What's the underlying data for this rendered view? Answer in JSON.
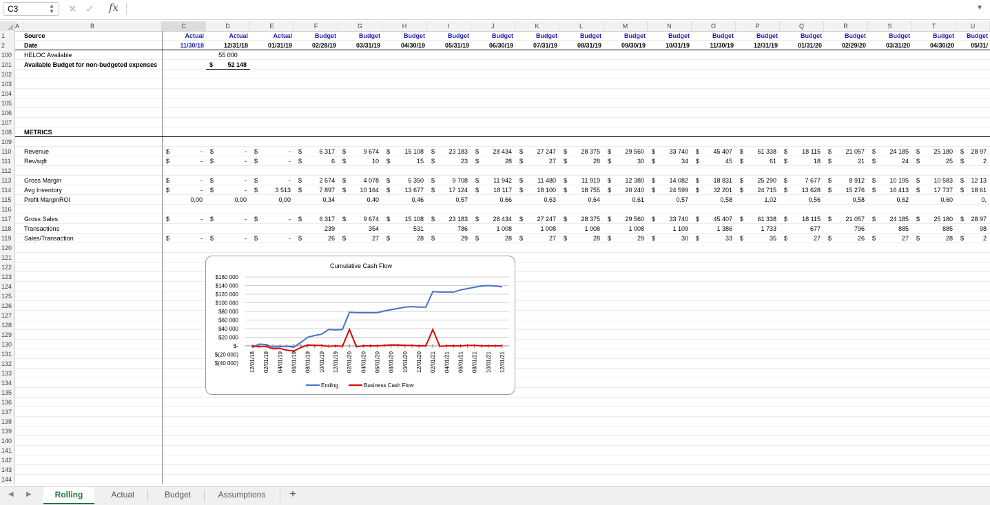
{
  "formula_bar": {
    "name_box": "C3",
    "cancel_icon": "✕",
    "enter_icon": "✓",
    "fx_label": "fx",
    "formula": ""
  },
  "columns": [
    {
      "letter": "A"
    },
    {
      "letter": "B"
    },
    {
      "letter": "C"
    },
    {
      "letter": "D"
    },
    {
      "letter": "E"
    },
    {
      "letter": "F"
    },
    {
      "letter": "G"
    },
    {
      "letter": "H"
    },
    {
      "letter": "I"
    },
    {
      "letter": "J"
    },
    {
      "letter": "K"
    },
    {
      "letter": "L"
    },
    {
      "letter": "M"
    },
    {
      "letter": "N"
    },
    {
      "letter": "O"
    },
    {
      "letter": "P"
    },
    {
      "letter": "Q"
    },
    {
      "letter": "R"
    },
    {
      "letter": "S"
    },
    {
      "letter": "T"
    },
    {
      "letter": "U"
    }
  ],
  "row_numbers": [
    "1",
    "2",
    "100",
    "101",
    "102",
    "103",
    "104",
    "105",
    "106",
    "107",
    "108",
    "109",
    "110",
    "111",
    "112",
    "113",
    "114",
    "115",
    "116",
    "117",
    "118",
    "119",
    "120",
    "121",
    "122",
    "123",
    "124",
    "125",
    "126",
    "127",
    "128",
    "129",
    "130",
    "131",
    "132",
    "133",
    "134",
    "135",
    "136",
    "137",
    "138",
    "139",
    "140",
    "141",
    "142",
    "143",
    "144"
  ],
  "labels": {
    "source": "Source",
    "date": "Date",
    "heloc": "HELOC Available",
    "avail_budget": "Available Budget for non-budgeted expenses",
    "metrics": "METRICS",
    "revenue": "Revenue",
    "rev_sqft": "Rev/sqft",
    "gross_margin": "Gross Margin",
    "avg_inventory": "Avg Inventory",
    "profit_margin_roi": "Profit MarginROI",
    "gross_sales": "Gross Sales",
    "transactions": "Transactions",
    "sales_transaction": "Sales/Transaction"
  },
  "sources": [
    "Actual",
    "Actual",
    "Actual",
    "Budget",
    "Budget",
    "Budget",
    "Budget",
    "Budget",
    "Budget",
    "Budget",
    "Budget",
    "Budget",
    "Budget",
    "Budget",
    "Budget",
    "Budget",
    "Budget",
    "Budget",
    "Budget",
    "Budg"
  ],
  "dates": [
    "11/30/18",
    "12/31/18",
    "01/31/19",
    "02/28/19",
    "03/31/19",
    "04/30/19",
    "05/31/19",
    "06/30/19",
    "07/31/19",
    "08/31/19",
    "09/30/19",
    "10/31/19",
    "11/30/19",
    "12/31/19",
    "01/31/20",
    "02/29/20",
    "03/31/20",
    "04/30/20",
    "05/31/"
  ],
  "heloc_value": "55 000",
  "avail_budget_value": "52 148",
  "currency_symbol": "$",
  "dash": "-",
  "metrics_rows": {
    "revenue": [
      "-",
      "-",
      "-",
      "6 317",
      "9 674",
      "15 108",
      "23 183",
      "28 434",
      "27 247",
      "28 375",
      "29 560",
      "33 740",
      "45 407",
      "61 338",
      "18 115",
      "21 057",
      "24 185",
      "25 180",
      "28 97"
    ],
    "rev_sqft": [
      "-",
      "-",
      "-",
      "6",
      "10",
      "15",
      "23",
      "28",
      "27",
      "28",
      "30",
      "34",
      "45",
      "61",
      "18",
      "21",
      "24",
      "25",
      "2"
    ],
    "gross_margin": [
      "-",
      "-",
      "-",
      "2 674",
      "4 078",
      "6 350",
      "9 708",
      "11 942",
      "11 480",
      "11 919",
      "12 380",
      "14 082",
      "18 831",
      "25 290",
      "7 677",
      "8 912",
      "10 195",
      "10 583",
      "12 13"
    ],
    "avg_inventory": [
      "-",
      "-",
      "3 513",
      "7 897",
      "10 164",
      "13 677",
      "17 124",
      "18 117",
      "18 100",
      "18 755",
      "20 240",
      "24 599",
      "32 201",
      "24 715",
      "13 628",
      "15 276",
      "16 413",
      "17 737",
      "18 61"
    ],
    "profit_margin_roi": [
      "0,00",
      "0,00",
      "0,00",
      "0,34",
      "0,40",
      "0,46",
      "0,57",
      "0,66",
      "0,63",
      "0,64",
      "0,61",
      "0,57",
      "0,58",
      "1,02",
      "0,56",
      "0,58",
      "0,62",
      "0,60",
      "0,"
    ],
    "gross_sales": [
      "-",
      "-",
      "-",
      "6 317",
      "9 674",
      "15 108",
      "23 183",
      "28 434",
      "27 247",
      "28 375",
      "29 560",
      "33 740",
      "45 407",
      "61 338",
      "18 115",
      "21 057",
      "24 185",
      "25 180",
      "28 97"
    ],
    "transactions": [
      "",
      "",
      "",
      "239",
      "354",
      "531",
      "786",
      "1 008",
      "1 008",
      "1 008",
      "1 008",
      "1 109",
      "1 386",
      "1 733",
      "677",
      "796",
      "885",
      "885",
      "98"
    ],
    "sales_transaction": [
      "-",
      "-",
      "-",
      "26",
      "27",
      "28",
      "29",
      "28",
      "27",
      "28",
      "29",
      "30",
      "33",
      "35",
      "27",
      "26",
      "27",
      "28",
      "2"
    ]
  },
  "chart_data": {
    "type": "line",
    "title": "Cumulative Cash Flow",
    "x": [
      "12/01/18",
      "01/01/19",
      "02/01/19",
      "03/01/19",
      "04/01/19",
      "05/01/19",
      "06/01/19",
      "07/01/19",
      "08/01/19",
      "09/01/19",
      "10/01/19",
      "11/01/19",
      "12/01/19",
      "01/01/20",
      "02/01/20",
      "03/01/20",
      "04/01/20",
      "05/01/20",
      "06/01/20",
      "07/01/20",
      "08/01/20",
      "09/01/20",
      "10/01/20",
      "11/01/20",
      "12/01/20",
      "01/01/21",
      "02/01/21",
      "03/01/21",
      "04/01/21",
      "05/01/21",
      "06/01/21",
      "07/01/21",
      "08/01/21",
      "09/01/21",
      "10/01/21",
      "11/01/21",
      "12/01/21"
    ],
    "x_tick_labels": [
      "12/01/18",
      "02/01/19",
      "04/01/19",
      "06/01/19",
      "08/01/19",
      "10/01/19",
      "12/01/19",
      "02/01/20",
      "04/01/20",
      "06/01/20",
      "08/01/20",
      "10/01/20",
      "12/01/20",
      "02/01/21",
      "04/01/21",
      "06/01/21",
      "08/01/21",
      "10/01/21",
      "12/01/21"
    ],
    "y_tick_labels": [
      "$160 000",
      "$140 000",
      "$120 000",
      "$100 000",
      "$80 000",
      "$60 000",
      "$40 000",
      "$20 000",
      "$-",
      "$(20 000)",
      "$(40 000)"
    ],
    "ylim": [
      -40000,
      160000
    ],
    "series": [
      {
        "name": "Ending",
        "color": "#4472c4",
        "values": [
          -4000,
          4000,
          3000,
          -3000,
          -2000,
          -1000,
          -3000,
          8000,
          20000,
          24000,
          27000,
          38000,
          37000,
          38000,
          78000,
          77000,
          77000,
          77000,
          77000,
          81000,
          84000,
          87000,
          90000,
          91000,
          90000,
          90000,
          126000,
          125000,
          125000,
          125000,
          130000,
          133000,
          136000,
          139000,
          140000,
          139000,
          137000
        ]
      },
      {
        "name": "Business Cash Flow",
        "color": "#e00000",
        "values": [
          0,
          -2000,
          -1000,
          -7000,
          -6000,
          -10000,
          -12000,
          -4000,
          2000,
          1000,
          1000,
          -1000,
          0,
          -1000,
          38000,
          -2000,
          0,
          0,
          0,
          1000,
          2000,
          2000,
          1000,
          1000,
          0,
          0,
          38000,
          -1000,
          0,
          0,
          0,
          1000,
          1000,
          0,
          0,
          0,
          0
        ]
      }
    ],
    "grid": true,
    "legend": "bottom"
  },
  "tabs": [
    {
      "label": "Rolling",
      "active": true
    },
    {
      "label": "Actual",
      "active": false
    },
    {
      "label": "Budget",
      "active": false
    },
    {
      "label": "Assumptions",
      "active": false
    }
  ],
  "add_sheet": "+",
  "icons": {
    "prev": "◀",
    "next": "▶",
    "dropdown": "▼"
  }
}
